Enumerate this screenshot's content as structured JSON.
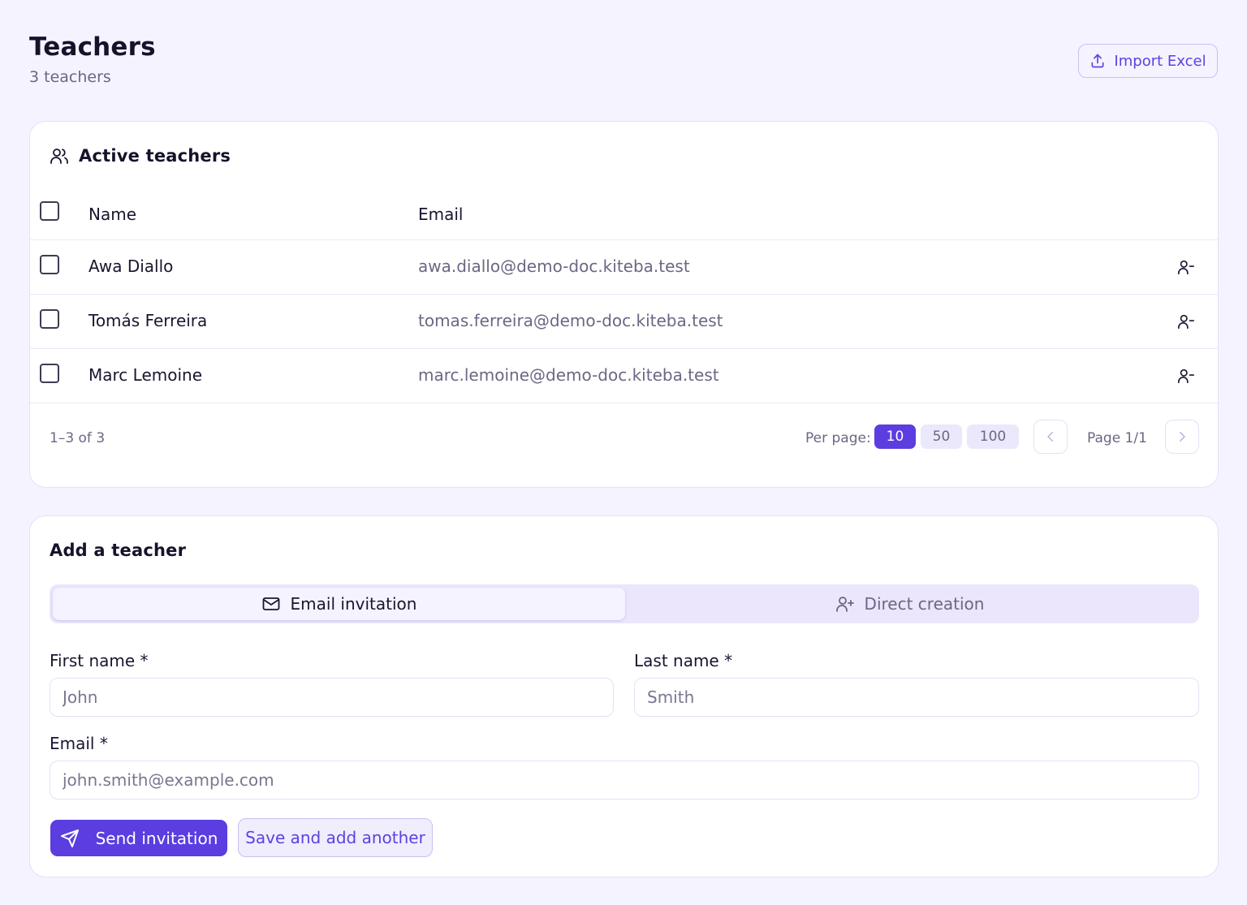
{
  "page": {
    "title": "Teachers",
    "subtitle": "3 teachers",
    "import_label": "Import Excel"
  },
  "active_card": {
    "title": "Active teachers",
    "columns": {
      "name": "Name",
      "email": "Email"
    },
    "rows": [
      {
        "name": "Awa Diallo",
        "email": "awa.diallo@demo-doc.kiteba.test"
      },
      {
        "name": "Tomás Ferreira",
        "email": "tomas.ferreira@demo-doc.kiteba.test"
      },
      {
        "name": "Marc Lemoine",
        "email": "marc.lemoine@demo-doc.kiteba.test"
      }
    ],
    "pagination": {
      "range": "1–3 of 3",
      "per_page_label": "Per page:",
      "options": [
        "10",
        "50",
        "100"
      ],
      "selected": "10",
      "page_label": "Page 1/1"
    }
  },
  "add_card": {
    "title": "Add a teacher",
    "tabs": {
      "email": "Email invitation",
      "direct": "Direct creation"
    },
    "fields": {
      "first_name": {
        "label": "First name *",
        "placeholder": "John"
      },
      "last_name": {
        "label": "Last name *",
        "placeholder": "Smith"
      },
      "email": {
        "label": "Email *",
        "placeholder": "john.smith@example.com"
      }
    },
    "send_label": "Send invitation",
    "save_label": "Save and add another"
  },
  "colors": {
    "accent": "#5b3de0",
    "background": "#f5f3ff",
    "border": "#e4e0f7"
  },
  "icons": [
    "upload-icon",
    "users-icon",
    "user-minus-icon",
    "chevron-left-icon",
    "chevron-right-icon",
    "mail-icon",
    "user-plus-icon",
    "send-icon"
  ]
}
